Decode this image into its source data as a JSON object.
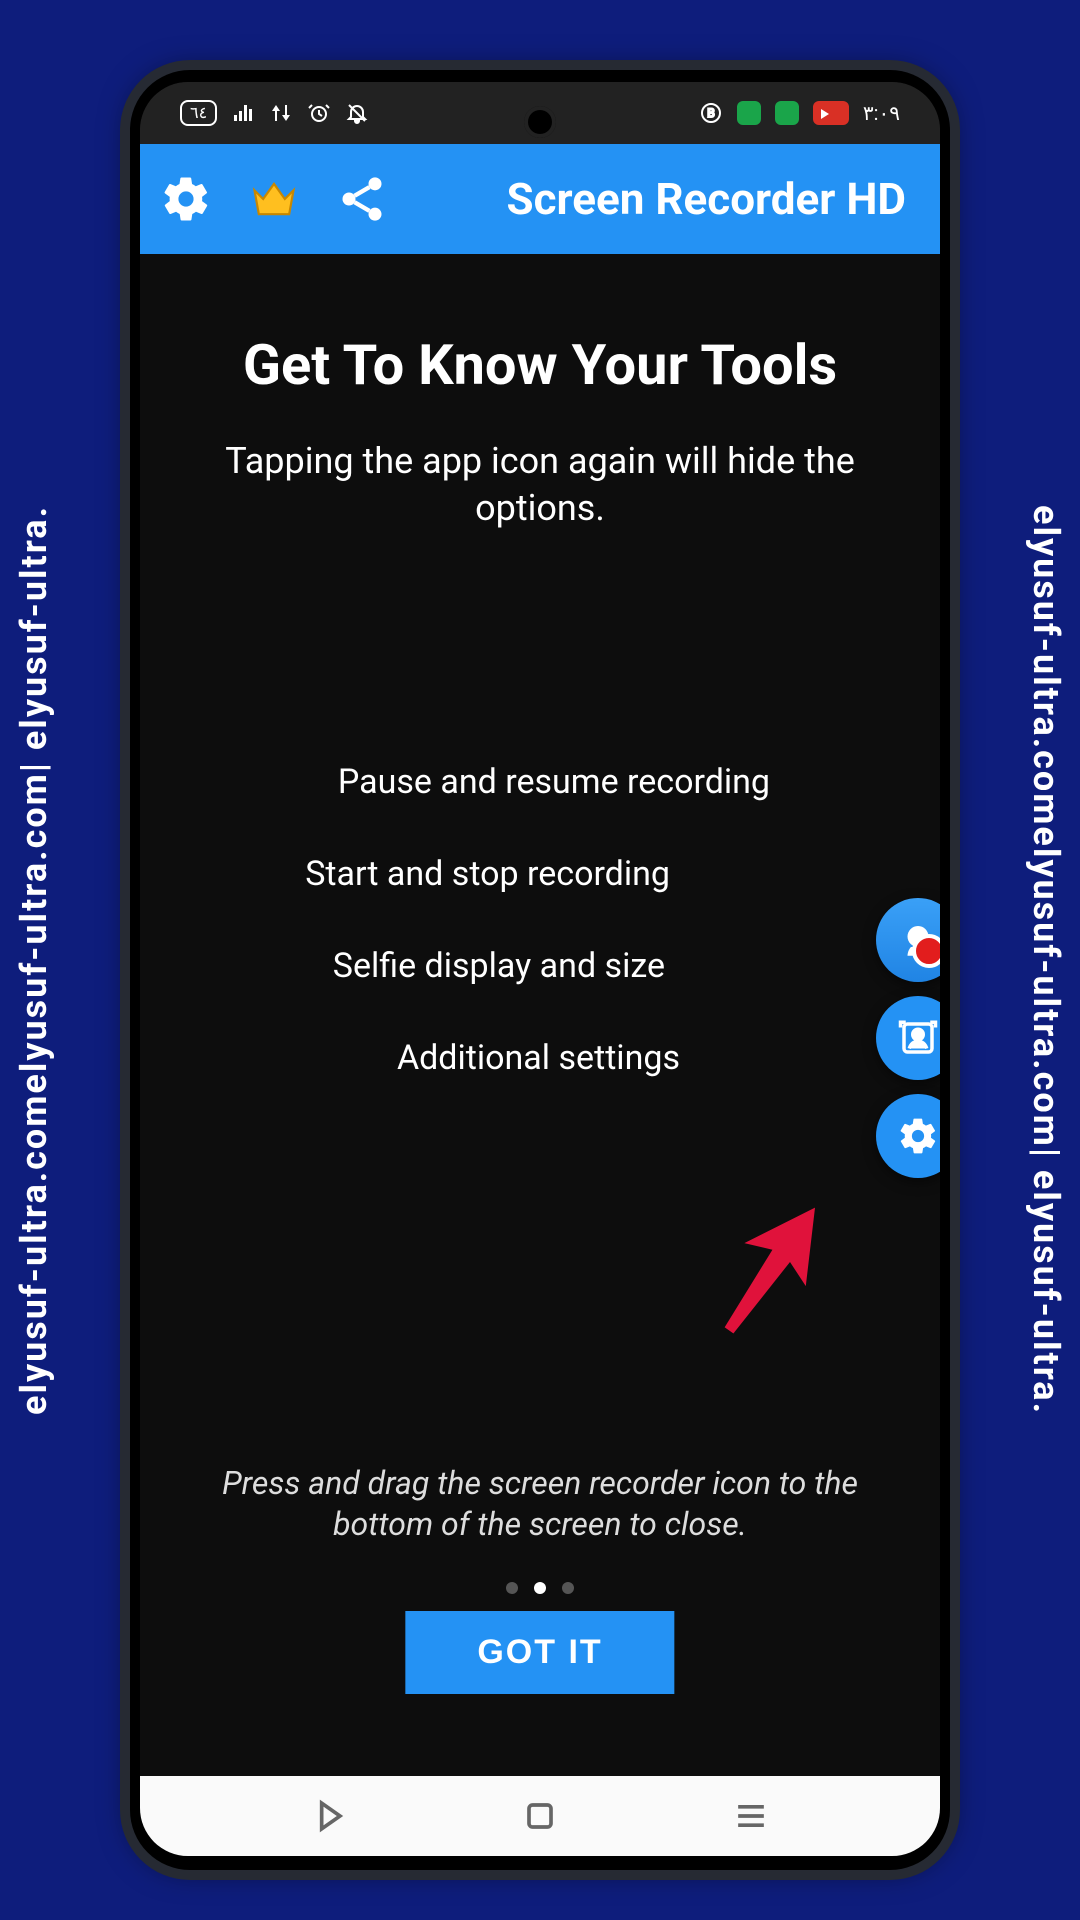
{
  "watermark": "elyusuf-ultra.comelyusuf-ultra.com| elyusuf-ultra.",
  "statusbar": {
    "battery_label": "٦٤",
    "clock": "٣:٠٩"
  },
  "appbar": {
    "title": "Screen Recorder HD",
    "settings_icon": "gear-icon",
    "premium_icon": "crown-icon",
    "share_icon": "share-icon"
  },
  "tutorial": {
    "title": "Get To Know Your Tools",
    "subtitle": "Tapping the app icon again will hide the options.",
    "labels": [
      "Pause and resume recording",
      "Start and stop recording",
      "Selfie display and size",
      "Additional settings"
    ],
    "tip": "Press and drag the screen recorder icon to the bottom of the screen to close.",
    "button": "GOT IT",
    "page_index": 1,
    "page_count": 3
  },
  "float": {
    "app": "record-app-icon",
    "selfie": "selfie-icon",
    "settings": "gear-icon"
  }
}
